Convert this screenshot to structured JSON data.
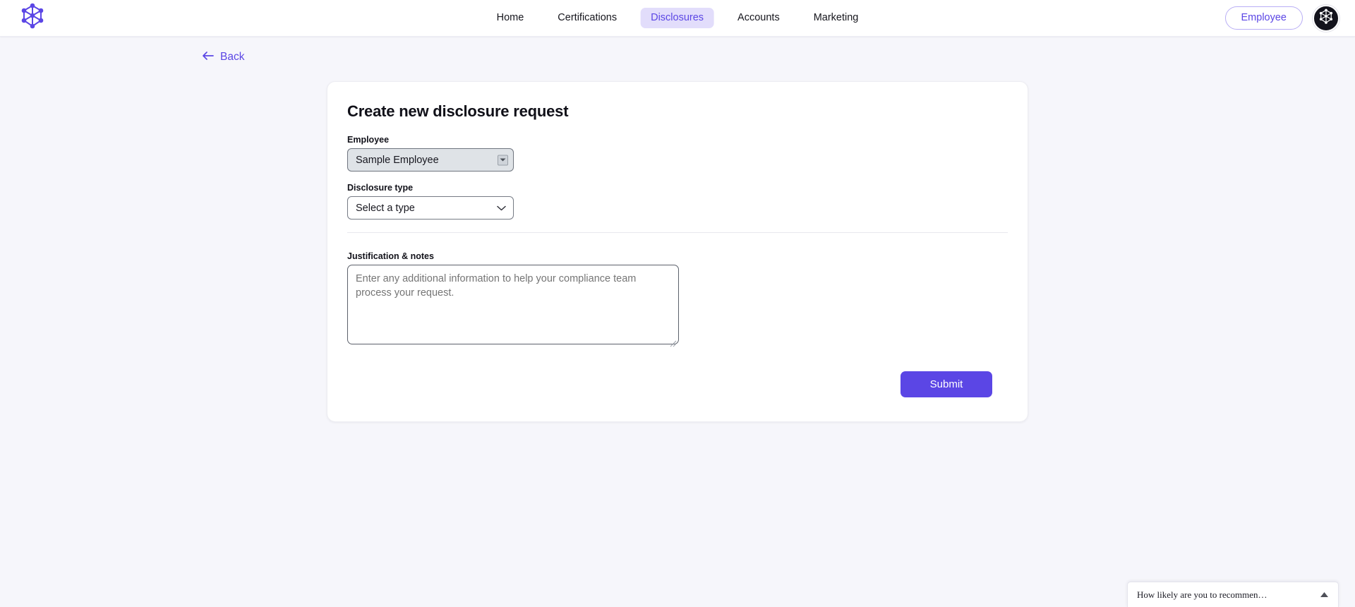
{
  "brand": {
    "logo_icon": "network-graph-logo-icon",
    "accent_color": "#5b46e5",
    "accent_soft_color": "#e2ddfb",
    "page_bg_color": "#f6f6fb"
  },
  "topnav": {
    "links": [
      {
        "label": "Home",
        "active": false
      },
      {
        "label": "Certifications",
        "active": false
      },
      {
        "label": "Disclosures",
        "active": true
      },
      {
        "label": "Accounts",
        "active": false
      },
      {
        "label": "Marketing",
        "active": false
      }
    ],
    "employee_button_label": "Employee",
    "avatar_icon": "avatar-logo-icon"
  },
  "page": {
    "back_label": "Back",
    "back_icon": "arrow-left-icon"
  },
  "card": {
    "title": "Create new disclosure request",
    "employee": {
      "label": "Employee",
      "value": "Sample Employee",
      "caret_icon": "dropdown-arrow-icon"
    },
    "disclosure_type": {
      "label": "Disclosure type",
      "value": "Select a type",
      "caret_icon": "chevron-down-icon"
    },
    "justification": {
      "label": "Justification & notes",
      "value": "",
      "placeholder": "Enter any additional information to help your compliance team process your request."
    },
    "submit_label": "Submit"
  },
  "nps": {
    "question": "How likely are you to recommen…",
    "collapse_icon": "caret-up-icon"
  }
}
